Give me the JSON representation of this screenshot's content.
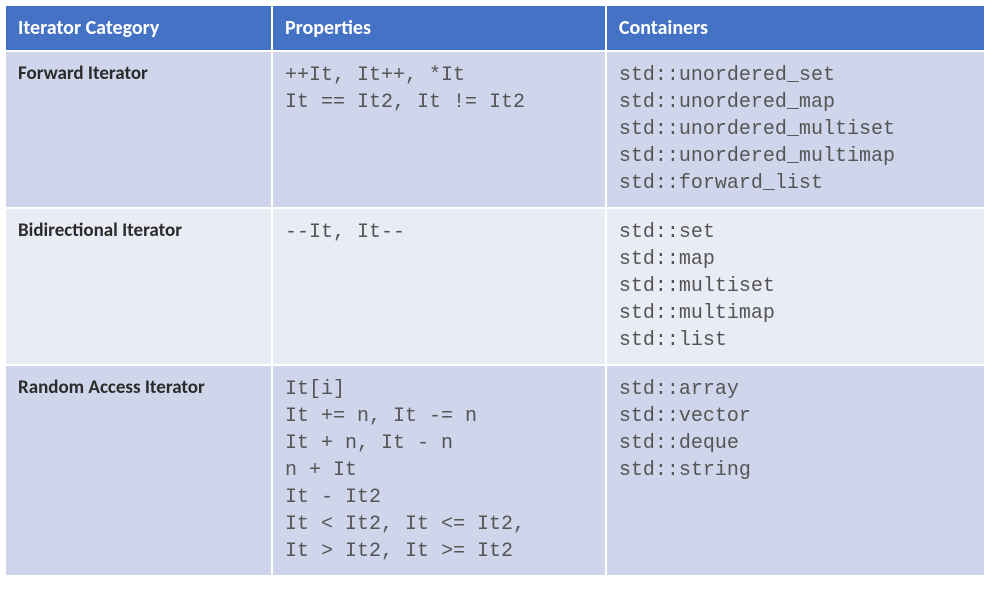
{
  "table": {
    "headers": [
      "Iterator Category",
      "Properties",
      "Containers"
    ],
    "rows": [
      {
        "category": "Forward Iterator",
        "properties": "++It, It++, *It\nIt == It2, It != It2",
        "containers": "std::unordered_set\nstd::unordered_map\nstd::unordered_multiset\nstd::unordered_multimap\nstd::forward_list"
      },
      {
        "category": "Bidirectional Iterator",
        "properties": "--It, It--",
        "containers": "std::set\nstd::map\nstd::multiset\nstd::multimap\nstd::list"
      },
      {
        "category": "Random Access Iterator",
        "properties": "It[i]\nIt += n, It -= n\nIt + n, It - n\nn + It\nIt - It2\nIt < It2, It <= It2,\nIt > It2, It >= It2",
        "containers": "std::array\nstd::vector\nstd::deque\nstd::string"
      }
    ]
  }
}
